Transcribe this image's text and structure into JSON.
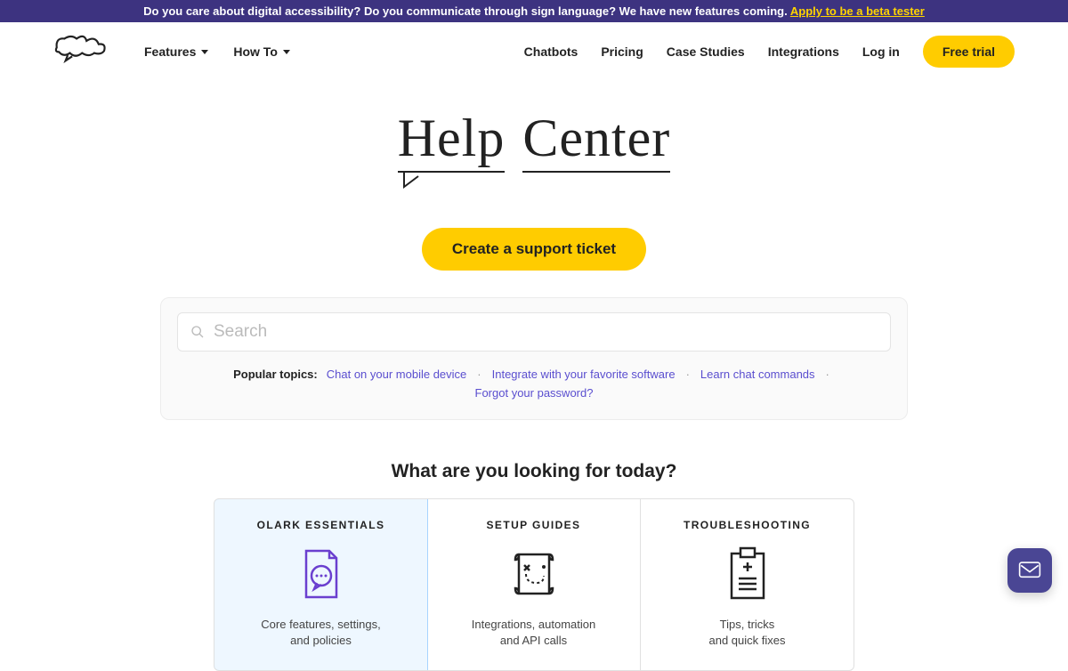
{
  "banner": {
    "text": "Do you care about digital accessibility? Do you communicate through sign language? We have new features coming. ",
    "link": "Apply to be a beta tester"
  },
  "nav": {
    "logo": "Olark",
    "left": [
      {
        "label": "Features"
      },
      {
        "label": "How To"
      }
    ],
    "right": [
      {
        "label": "Chatbots"
      },
      {
        "label": "Pricing"
      },
      {
        "label": "Case Studies"
      },
      {
        "label": "Integrations"
      },
      {
        "label": "Log in"
      }
    ],
    "free_trial": "Free trial"
  },
  "hero": {
    "help": "Help",
    "center": "Center"
  },
  "cta": {
    "label": "Create a support ticket"
  },
  "search": {
    "placeholder": "Search"
  },
  "popular": {
    "label": "Popular topics:",
    "links": [
      "Chat on your mobile device",
      "Integrate with your favorite software",
      "Learn chat commands",
      "Forgot your password?"
    ]
  },
  "section_title": "What are you looking for today?",
  "cards": [
    {
      "title": "OLARK ESSENTIALS",
      "desc": "Core features, settings,\nand policies"
    },
    {
      "title": "SETUP GUIDES",
      "desc": "Integrations, automation\nand API calls"
    },
    {
      "title": "TROUBLESHOOTING",
      "desc": "Tips, tricks\nand quick fixes"
    }
  ]
}
